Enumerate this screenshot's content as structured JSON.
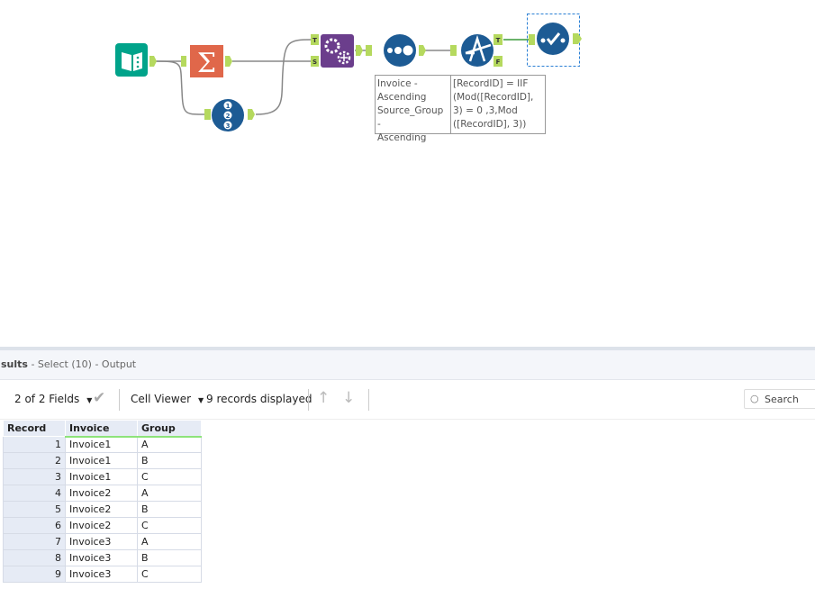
{
  "workflow": {
    "tools": [
      {
        "name": "Input Data",
        "icon": "book-icon",
        "color": "#00a38a"
      },
      {
        "name": "Summarize",
        "icon": "sigma-icon",
        "color": "#e0674a"
      },
      {
        "name": "Record ID",
        "icon": "record-id-icon",
        "color": "#1d5b94"
      },
      {
        "name": "Append Fields",
        "icon": "gears-icon",
        "color": "#6b3e8c"
      },
      {
        "name": "Sort",
        "icon": "dots-icon",
        "color": "#1d5b94"
      },
      {
        "name": "Formula",
        "icon": "formula-icon",
        "color": "#1d5b94"
      },
      {
        "name": "Select",
        "icon": "select-check-icon",
        "color": "#1d5b94"
      }
    ],
    "anchors": {
      "target": "T",
      "source": "S",
      "true": "T",
      "false": "F"
    },
    "sort_annotation": "Invoice -\nAscending\nSource_Group -\nAscending",
    "formula_annotation": "[RecordID] = IIF\n(Mod([RecordID],\n3) = 0 ,3,Mod\n([RecordID], 3))"
  },
  "results": {
    "title": "sults",
    "subtitle": "- Select (10) - Output",
    "fields": "2 of 2 Fields",
    "viewer": "Cell Viewer",
    "records_displayed": "9 records displayed",
    "search": "Search",
    "columns": [
      "Record",
      "Invoice",
      "Group"
    ],
    "rows": [
      [
        "1",
        "Invoice1",
        "A"
      ],
      [
        "2",
        "Invoice1",
        "B"
      ],
      [
        "3",
        "Invoice1",
        "C"
      ],
      [
        "4",
        "Invoice2",
        "A"
      ],
      [
        "5",
        "Invoice2",
        "B"
      ],
      [
        "6",
        "Invoice2",
        "C"
      ],
      [
        "7",
        "Invoice3",
        "A"
      ],
      [
        "8",
        "Invoice3",
        "B"
      ],
      [
        "9",
        "Invoice3",
        "C"
      ]
    ]
  }
}
